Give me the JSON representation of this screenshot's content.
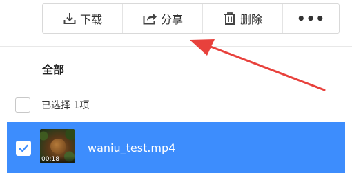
{
  "toolbar": {
    "download_label": "下载",
    "share_label": "分享",
    "delete_label": "删除",
    "more_label": "•••"
  },
  "section": {
    "title": "全部"
  },
  "selection": {
    "count_text": "已选择 1项"
  },
  "file": {
    "name": "waniu_test.mp4",
    "duration": "00:18",
    "selected": true
  },
  "colors": {
    "selected_row": "#3d8dfd",
    "annotation_arrow": "#e8413c"
  },
  "icons": [
    "download-icon",
    "share-icon",
    "trash-icon",
    "more-icon",
    "check-icon"
  ]
}
